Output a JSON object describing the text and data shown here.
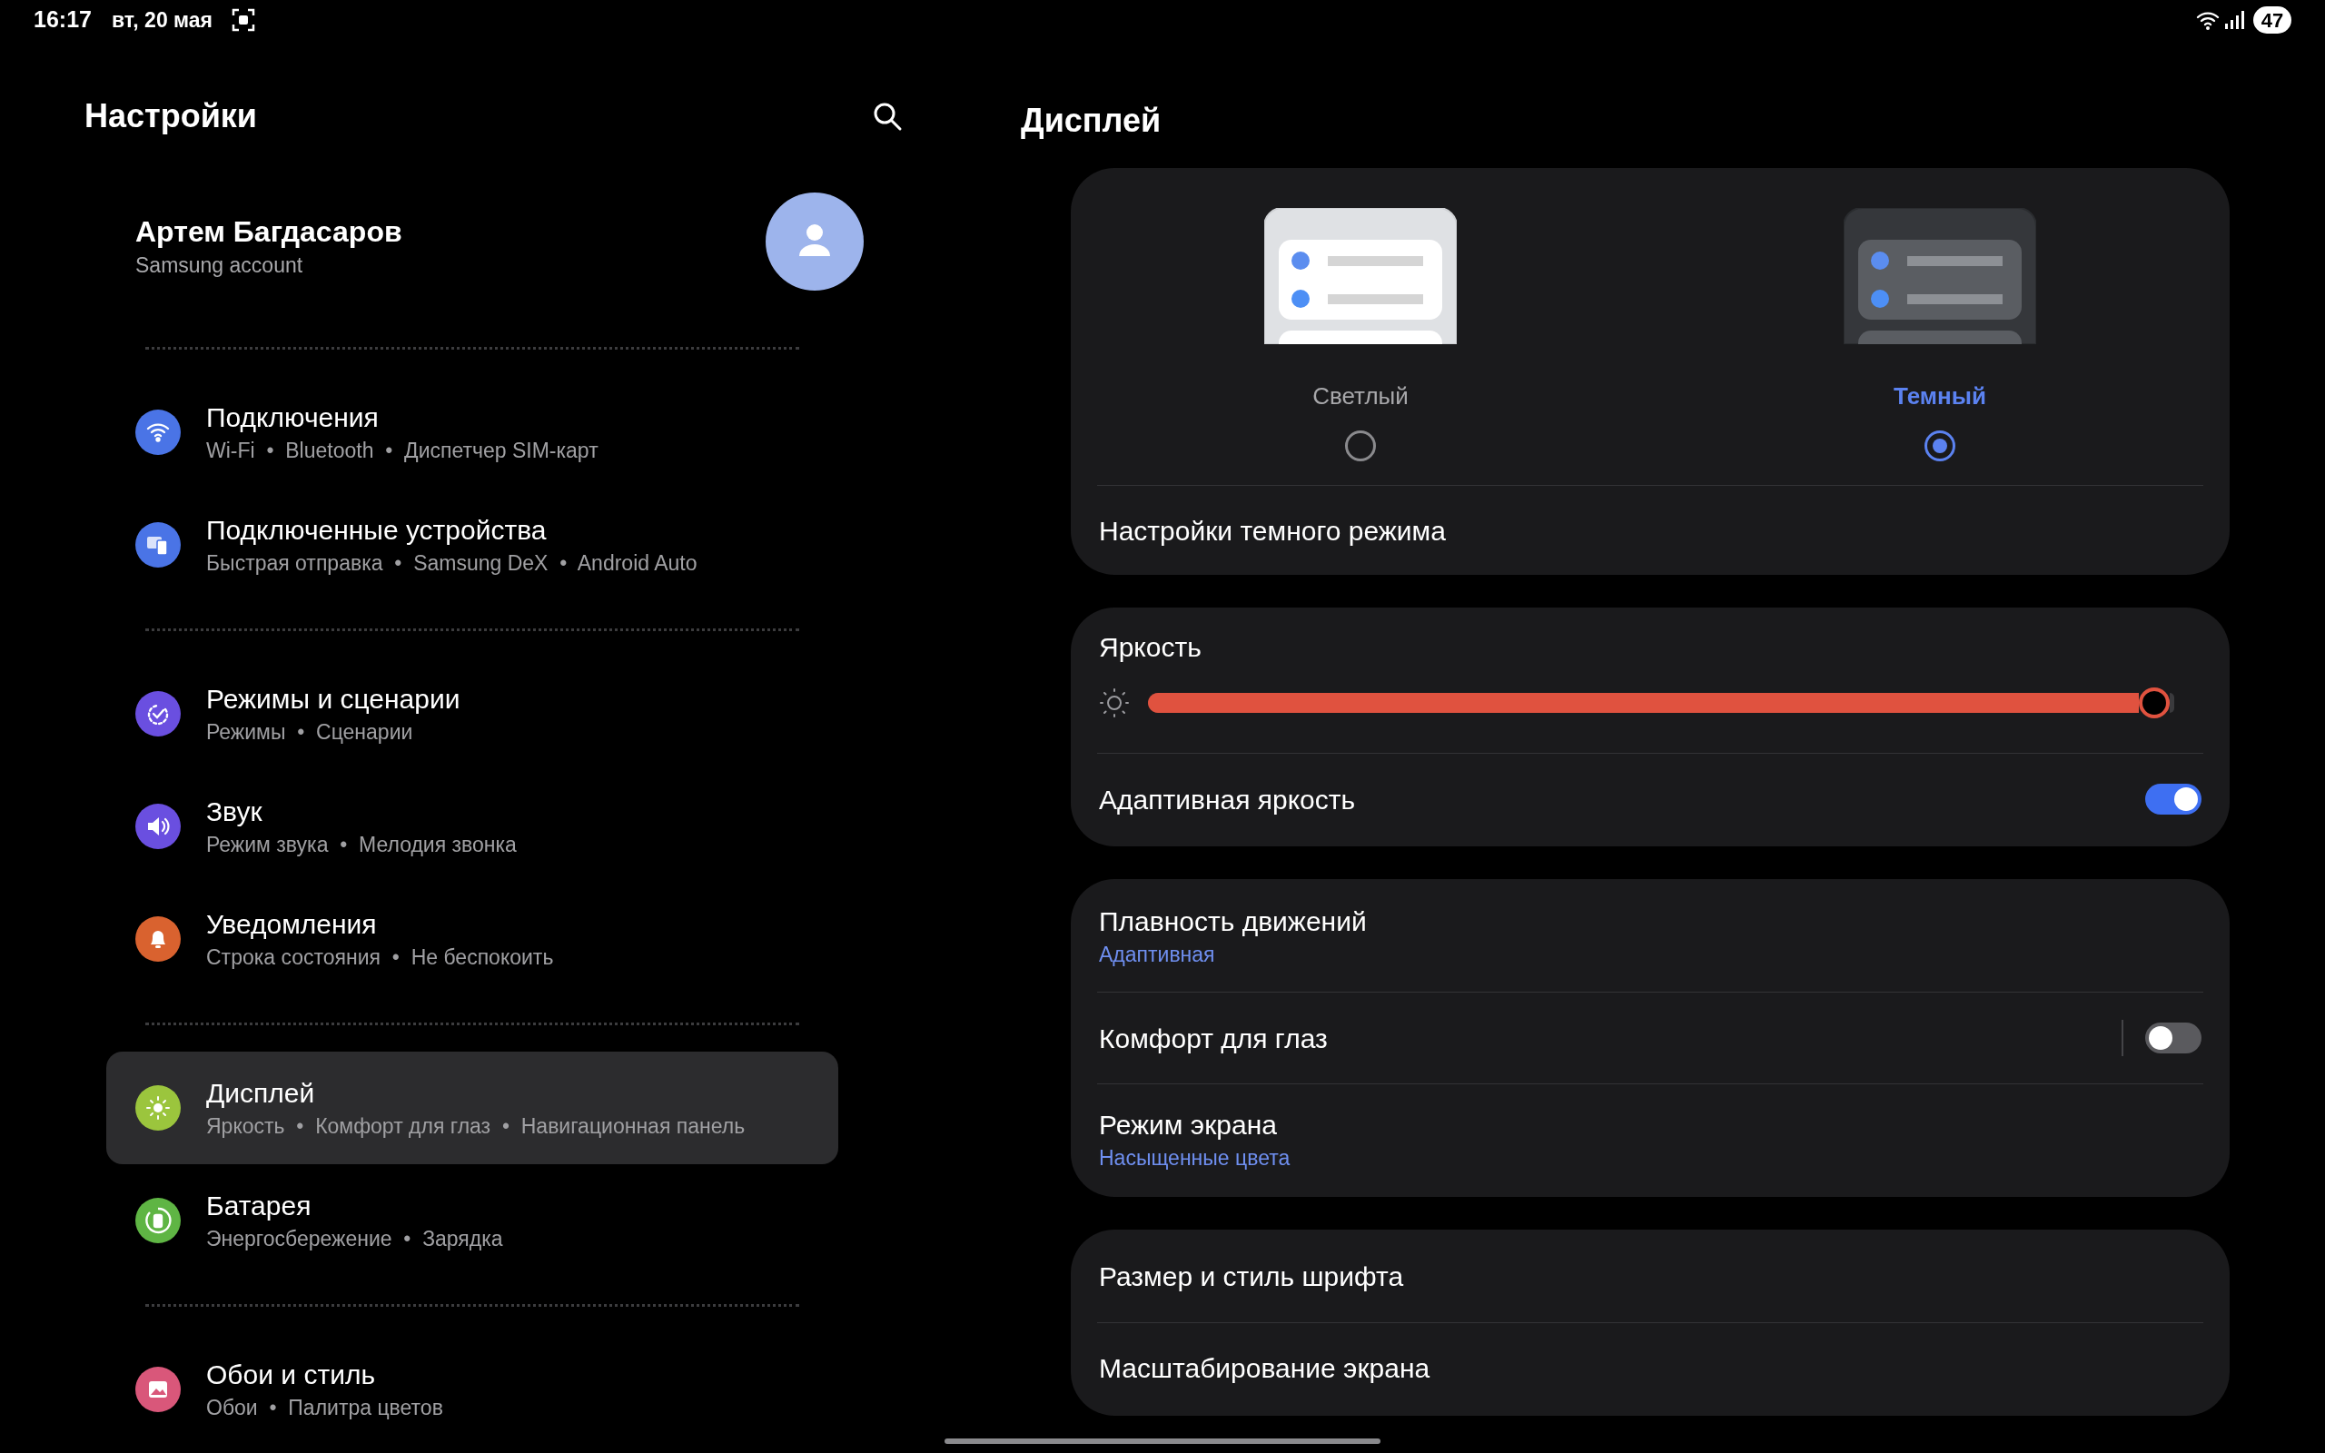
{
  "status_bar": {
    "time": "16:17",
    "date": "вт, 20 мая",
    "battery": "47"
  },
  "sidebar": {
    "title": "Настройки",
    "profile": {
      "name": "Артем Багдасаров",
      "subtitle": "Samsung account"
    },
    "groups": [
      [
        {
          "title": "Подключения",
          "subtitle": "Wi-Fi  •  Bluetooth  •  Диспетчер SIM-карт",
          "color": "#4a74e6",
          "selected": false
        },
        {
          "title": "Подключенные устройства",
          "subtitle": "Быстрая отправка  •  Samsung DeX  •  Android Auto",
          "color": "#4a74e6",
          "selected": false
        }
      ],
      [
        {
          "title": "Режимы и сценарии",
          "subtitle": "Режимы  •  Сценарии",
          "color": "#6a4fe0",
          "selected": false
        },
        {
          "title": "Звук",
          "subtitle": "Режим звука  •  Мелодия звонка",
          "color": "#6a4fe0",
          "selected": false
        },
        {
          "title": "Уведомления",
          "subtitle": "Строка состояния  •  Не беспокоить",
          "color": "#d9622f",
          "selected": false
        }
      ],
      [
        {
          "title": "Дисплей",
          "subtitle": "Яркость  •  Комфорт для глаз  •  Навигационная панель",
          "color": "#9bc53d",
          "selected": true
        },
        {
          "title": "Батарея",
          "subtitle": "Энергосбережение  •  Зарядка",
          "color": "#5fb544",
          "selected": false
        }
      ],
      [
        {
          "title": "Обои и стиль",
          "subtitle": "Обои  •  Палитра цветов",
          "color": "#d9577a",
          "selected": false
        }
      ]
    ]
  },
  "display": {
    "title": "Дисплей",
    "themes": [
      {
        "label": "Светлый",
        "kind": "light",
        "selected": false
      },
      {
        "label": "Темный",
        "kind": "dark",
        "selected": true
      }
    ],
    "dark_mode_settings": "Настройки темного режима",
    "cards": [
      [
        {
          "kind": "slider",
          "label": "Яркость",
          "level": 0.995
        },
        {
          "kind": "toggle",
          "label": "Адаптивная яркость",
          "on": true
        }
      ],
      [
        {
          "kind": "link",
          "label": "Плавность движений",
          "value": "Адаптивная"
        },
        {
          "kind": "toggle",
          "label": "Комфорт для глаз",
          "on": false,
          "separator": true
        },
        {
          "kind": "link",
          "label": "Режим экрана",
          "value": "Насыщенные цвета"
        }
      ],
      [
        {
          "kind": "link",
          "label": "Размер и стиль шрифта"
        },
        {
          "kind": "link",
          "label": "Масштабирование экрана"
        }
      ]
    ]
  }
}
